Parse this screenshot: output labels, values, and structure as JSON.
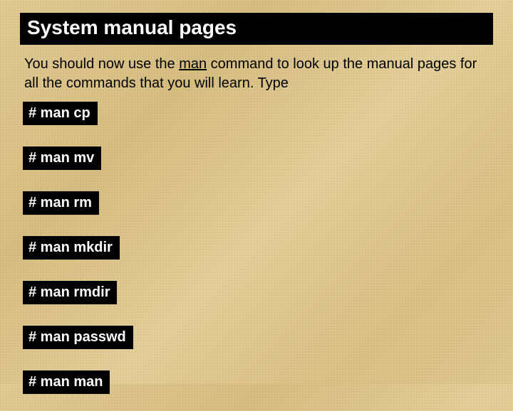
{
  "title": "System manual pages",
  "intro_pre": "You should now use the ",
  "intro_keyword": "man",
  "intro_post": " command to look up the manual pages for all the commands that you will learn. Type",
  "commands": [
    "# man cp",
    "# man mv",
    "# man rm",
    "# man mkdir",
    "# man rmdir",
    "# man passwd",
    "# man man"
  ]
}
